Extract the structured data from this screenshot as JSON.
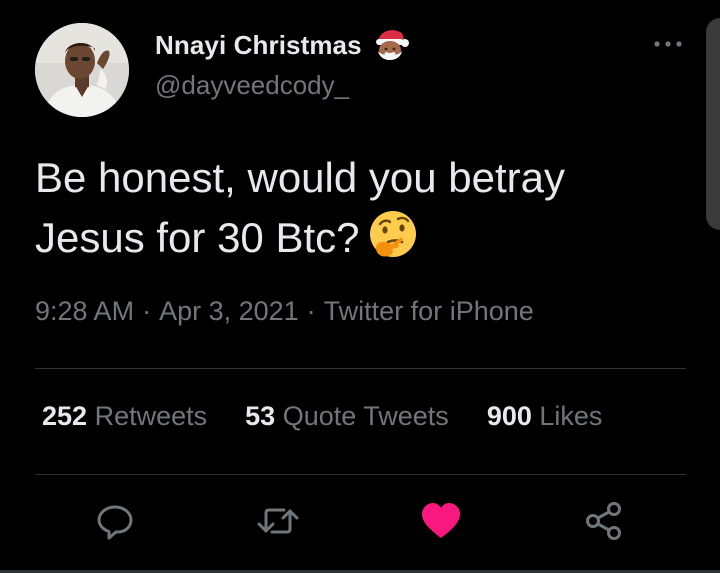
{
  "author": {
    "display_name": "Nnayi Christmas",
    "handle": "@dayveedcody_",
    "name_emoji": "santa-claus-emoji"
  },
  "tweet": {
    "text_lines": [
      "Be honest, would you betray",
      "Jesus for 30 Btc?"
    ],
    "emoji": "thinking-face-emoji"
  },
  "meta": {
    "time": "9:28 AM",
    "separator": "·",
    "date": "Apr 3, 2021",
    "source": "Twitter for iPhone"
  },
  "stats": [
    {
      "count": "252",
      "label": "Retweets"
    },
    {
      "count": "53",
      "label": "Quote Tweets"
    },
    {
      "count": "900",
      "label": "Likes"
    }
  ],
  "actions": [
    {
      "icon": "reply-icon"
    },
    {
      "icon": "retweet-icon"
    },
    {
      "icon": "heart-icon",
      "active": true,
      "color": "#f91880"
    },
    {
      "icon": "share-icon"
    }
  ],
  "colors": {
    "background": "#000000",
    "primary_text": "#e7e9ea",
    "secondary_text": "#71767b",
    "divider": "#2f3336",
    "like_active": "#f91880"
  }
}
